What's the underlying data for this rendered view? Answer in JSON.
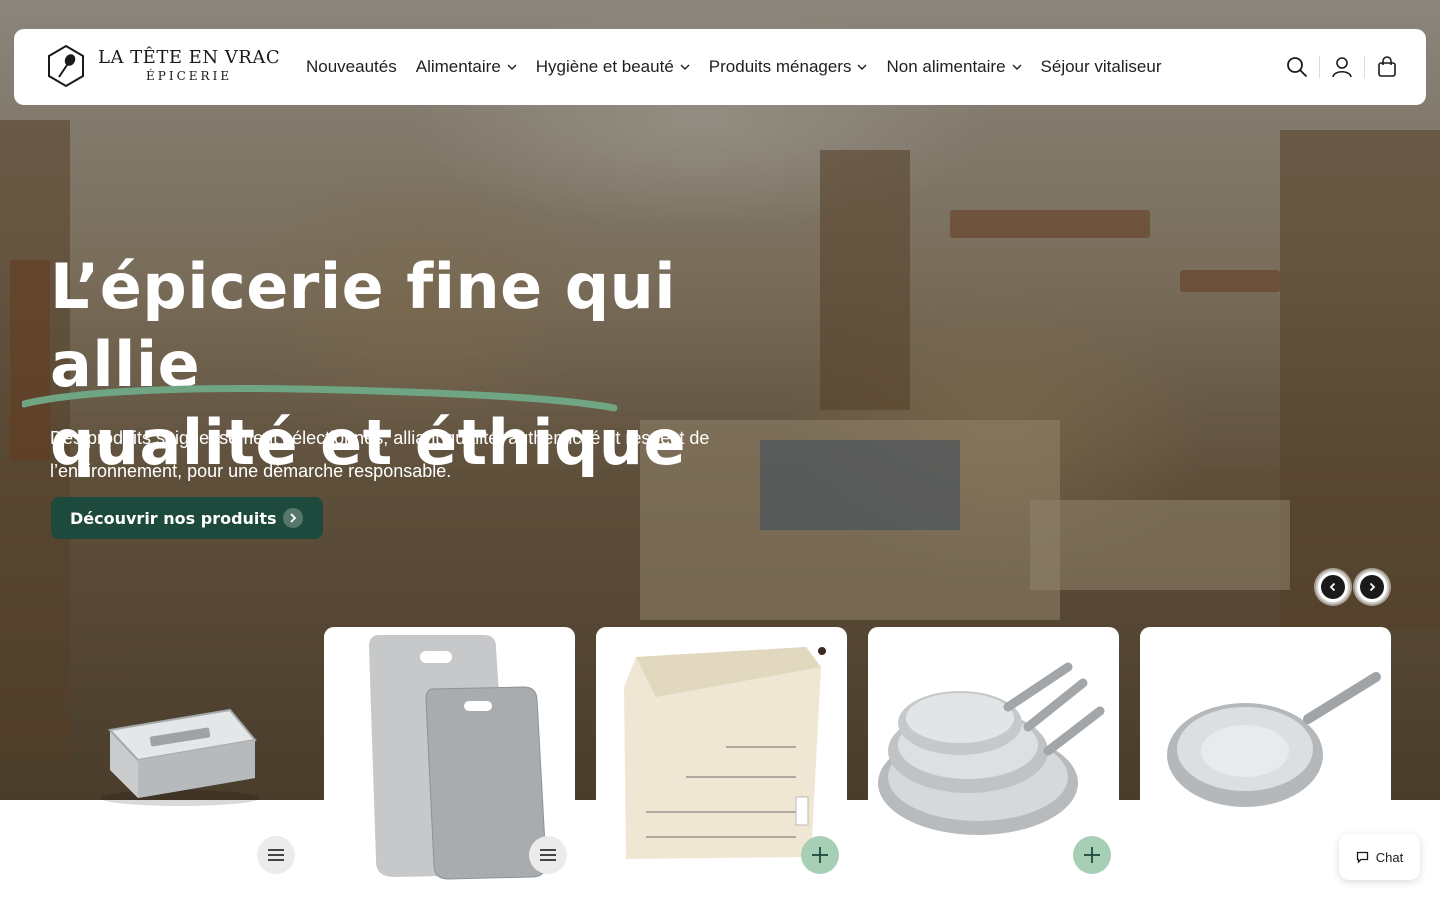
{
  "brand": {
    "name": "LA TÊTE EN VRAC",
    "sub": "ÉPICERIE"
  },
  "nav": [
    {
      "label": "Nouveautés",
      "dropdown": false
    },
    {
      "label": "Alimentaire",
      "dropdown": true
    },
    {
      "label": "Hygiène et beauté",
      "dropdown": true
    },
    {
      "label": "Produits ménagers",
      "dropdown": true
    },
    {
      "label": "Non alimentaire",
      "dropdown": true
    },
    {
      "label": "Séjour vitaliseur",
      "dropdown": false
    }
  ],
  "header_icons": [
    "search-icon",
    "account-icon",
    "cart-icon"
  ],
  "hero": {
    "title_line1": "L’épicerie fine qui allie",
    "title_line2": "qualité et éthique",
    "description": "Des produits soigneusement sélectionnés, alliant qualité, authenticité et respect de l’environnement, pour une démarche responsable.",
    "cta_label": "Découvrir nos produits"
  },
  "colors": {
    "accent_green": "#1d4a3c",
    "underline_green": "#6fa583",
    "fab_green": "#a6cfb6"
  },
  "products": [
    {
      "image": "stainless-lunch-box",
      "action": "menu"
    },
    {
      "image": "stainless-cutting-boards",
      "action": "menu"
    },
    {
      "image": "cotton-bulk-bag",
      "action": "add"
    },
    {
      "image": "stainless-frying-pan-set",
      "action": "add"
    },
    {
      "image": "stainless-frying-pan",
      "action": "none"
    }
  ],
  "chat": {
    "label": "Chat"
  }
}
